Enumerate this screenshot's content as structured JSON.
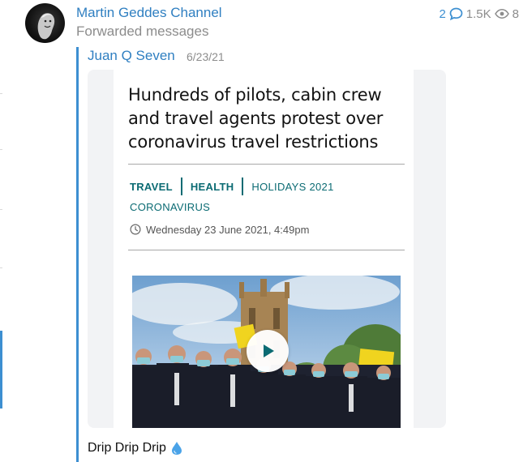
{
  "post": {
    "channel_name": "Martin Geddes Channel",
    "subtitle": "Forwarded messages",
    "author": "Juan Q Seven",
    "date": "6/23/21",
    "caption": "Drip Drip Drip",
    "caption_emoji": "droplet"
  },
  "stats": {
    "replies": "2",
    "views": "1.5K",
    "extra": "8"
  },
  "article": {
    "headline_lines": [
      "Hundreds of pilots, cabin crew",
      "and travel agents protest over",
      "coronavirus travel restrictions"
    ],
    "tags": [
      "TRAVEL",
      "HEALTH",
      "HOLIDAYS 2021"
    ],
    "tag_second_line": "CORONAVIRUS",
    "published": "Wednesday 23 June 2021, 4:49pm"
  },
  "icons": {
    "reply": "comment-bubble-icon",
    "views": "eye-icon",
    "clock": "clock-icon",
    "play": "play-icon",
    "droplet": "droplet-icon"
  },
  "colors": {
    "accent": "#3d8fd1",
    "link": "#2f7fc1",
    "tag": "#0b6b73"
  }
}
